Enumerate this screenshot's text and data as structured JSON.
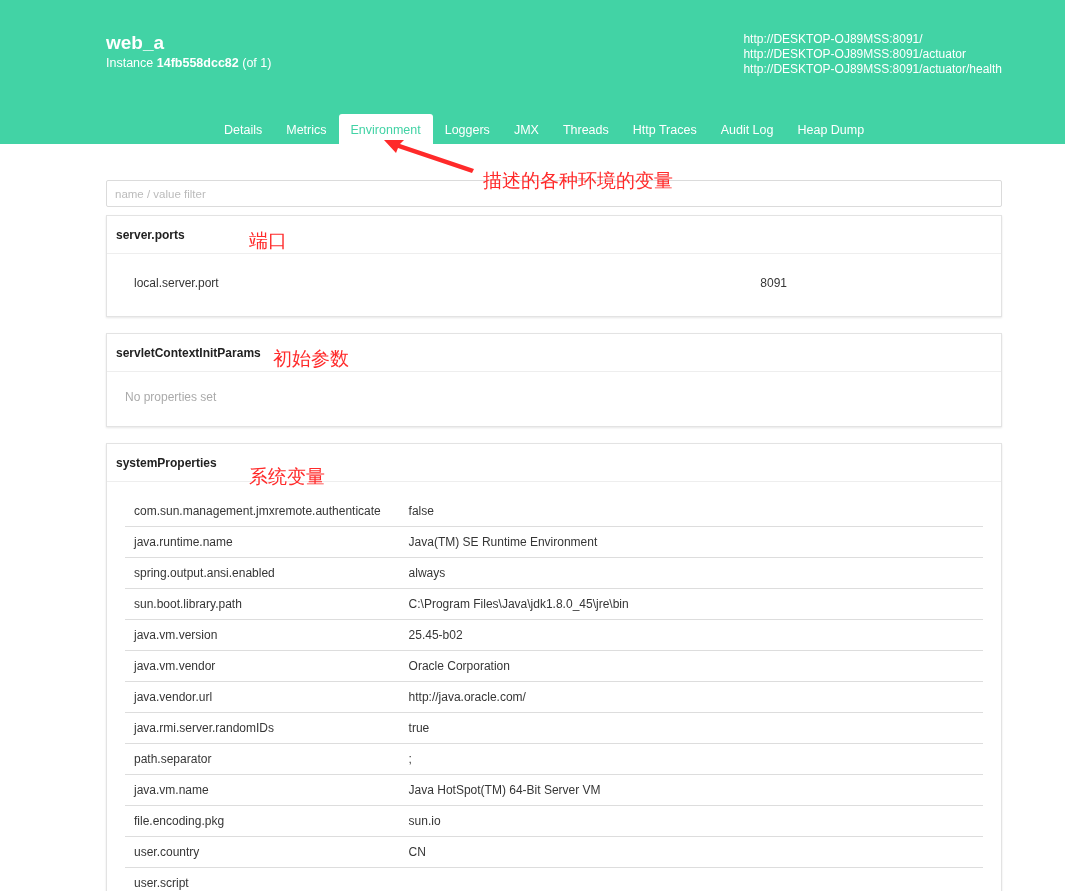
{
  "header": {
    "app_name": "web_a",
    "instance_label": "Instance",
    "instance_id": "14fb558dcc82",
    "instance_count": "(of 1)",
    "urls": [
      "http://DESKTOP-OJ89MSS:8091/",
      "http://DESKTOP-OJ89MSS:8091/actuator",
      "http://DESKTOP-OJ89MSS:8091/actuator/health"
    ]
  },
  "tabs": [
    {
      "label": "Details",
      "selected": false
    },
    {
      "label": "Metrics",
      "selected": false
    },
    {
      "label": "Environment",
      "selected": true
    },
    {
      "label": "Loggers",
      "selected": false
    },
    {
      "label": "JMX",
      "selected": false
    },
    {
      "label": "Threads",
      "selected": false
    },
    {
      "label": "Http Traces",
      "selected": false
    },
    {
      "label": "Audit Log",
      "selected": false
    },
    {
      "label": "Heap Dump",
      "selected": false
    }
  ],
  "tab_annotation": "描述的各种环境的变量",
  "filter": {
    "placeholder": "name / value filter"
  },
  "sections": [
    {
      "title": "server.ports",
      "annotation": "端口",
      "properties": [
        {
          "name": "local.server.port",
          "value": "8091"
        }
      ]
    },
    {
      "title": "servletContextInitParams",
      "annotation": "初始参数",
      "empty_text": "No properties set"
    },
    {
      "title": "systemProperties",
      "annotation": "系统变量",
      "properties": [
        {
          "name": "com.sun.management.jmxremote.authenticate",
          "value": "false"
        },
        {
          "name": "java.runtime.name",
          "value": "Java(TM) SE Runtime Environment"
        },
        {
          "name": "spring.output.ansi.enabled",
          "value": "always"
        },
        {
          "name": "sun.boot.library.path",
          "value": "C:\\Program Files\\Java\\jdk1.8.0_45\\jre\\bin"
        },
        {
          "name": "java.vm.version",
          "value": "25.45-b02"
        },
        {
          "name": "java.vm.vendor",
          "value": "Oracle Corporation"
        },
        {
          "name": "java.vendor.url",
          "value": "http://java.oracle.com/"
        },
        {
          "name": "java.rmi.server.randomIDs",
          "value": "true"
        },
        {
          "name": "path.separator",
          "value": ";"
        },
        {
          "name": "java.vm.name",
          "value": "Java HotSpot(TM) 64-Bit Server VM"
        },
        {
          "name": "file.encoding.pkg",
          "value": "sun.io"
        },
        {
          "name": "user.country",
          "value": "CN"
        },
        {
          "name": "user.script"
        }
      ]
    }
  ]
}
